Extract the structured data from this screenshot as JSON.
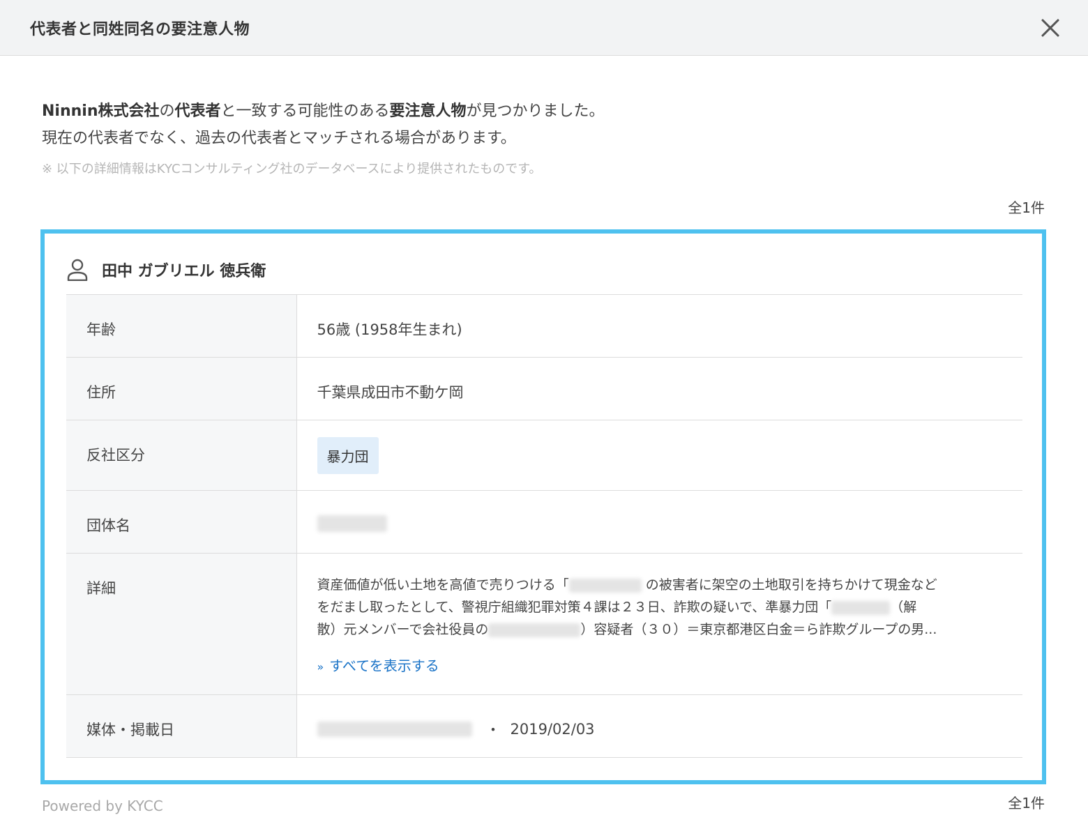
{
  "header": {
    "title": "代表者と同姓同名の要注意人物"
  },
  "intro": {
    "company": "Ninnin株式会社",
    "particle1": "の",
    "rep": "代表者",
    "mid": "と一致する可能性のある",
    "person": "要注意人物",
    "end": "が見つかりました。",
    "line2": "現在の代表者でなく、過去の代表者とマッチされる場合があります。",
    "note": "※ 以下の詳細情報はKYCコンサルティング社のデータベースにより提供されたものです。"
  },
  "count_label": "全1件",
  "person": {
    "name": "田中 ガブリエル 徳兵衛",
    "rows": {
      "age_label": "年齢",
      "age_value": "56歳 (1958年生まれ)",
      "address_label": "住所",
      "address_value": "千葉県成田市不動ケ岡",
      "class_label": "反社区分",
      "class_value": "暴力団",
      "group_label": "団体名",
      "detail_label": "詳細",
      "detail_line1a": "資産価値が低い土地を高値で売りつける「",
      "detail_line1b": "の被害者に架空の土地取引を持ちかけて現金など",
      "detail_line2a": "をだまし取ったとして、警視庁組織犯罪対策４課は２３日、詐欺の疑いで、準暴力団「",
      "detail_line2b": "（解",
      "detail_line3a": "散）元メンバーで会社役員の",
      "detail_line3b": "）容疑者（３０）＝東京都港区白金＝ら詐欺グループの男...",
      "show_all": "すべてを表示する",
      "media_label": "媒体・掲載日",
      "media_sep": "・",
      "media_date": "2019/02/03"
    }
  },
  "footer": {
    "powered": "Powered by KYCC"
  },
  "colors": {
    "card_border": "#4ec1ef",
    "tag_bg": "#e1eefa",
    "link": "#1a73c7"
  }
}
